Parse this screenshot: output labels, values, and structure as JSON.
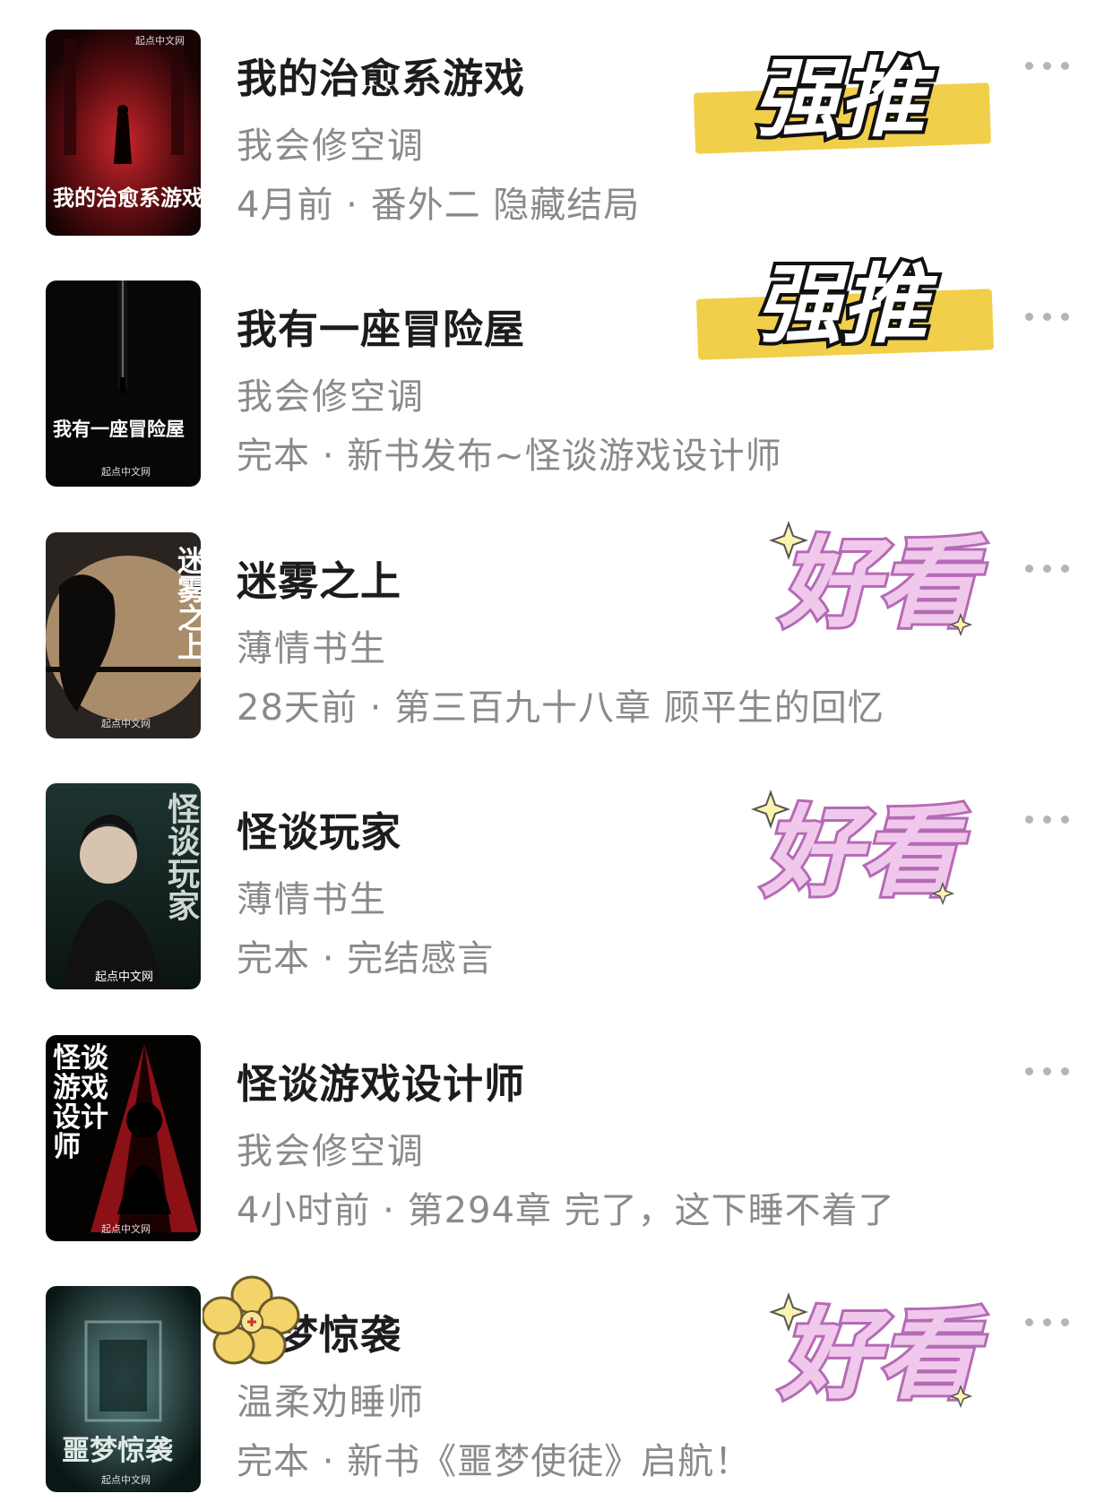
{
  "books": [
    {
      "title": "我的治愈系游戏",
      "author": "我会修空调",
      "meta": "4月前 · 番外二 隐藏结局",
      "cover_text": "我的治愈系游戏",
      "cover_publisher": "起点中文网",
      "badge": "强推"
    },
    {
      "title": "我有一座冒险屋",
      "author": "我会修空调",
      "meta": "完本 · 新书发布~怪谈游戏设计师",
      "cover_text": "我有一座冒险屋",
      "cover_publisher": "起点中文网",
      "badge": "强推"
    },
    {
      "title": "迷雾之上",
      "author": "薄情书生",
      "meta": "28天前 · 第三百九十八章 顾平生的回忆",
      "cover_text": "迷雾之上",
      "cover_publisher": "起点中文网",
      "badge": "好看"
    },
    {
      "title": "怪谈玩家",
      "author": "薄情书生",
      "meta": "完本 · 完结感言",
      "cover_text": "怪谈玩家",
      "cover_publisher": "起点中文网",
      "badge": "好看"
    },
    {
      "title": "怪谈游戏设计师",
      "author": "我会修空调",
      "meta": "4小时前 · 第294章 完了，这下睡不着了",
      "cover_text": "怪谈游戏设计师",
      "cover_publisher": "起点中文网",
      "badge": ""
    },
    {
      "title": "噩梦惊袭",
      "author": "温柔劝睡师",
      "meta": "完本 · 新书《噩梦使徒》启航！",
      "cover_text": "噩梦惊袭",
      "cover_publisher": "起点中文网",
      "badge": "好看"
    }
  ],
  "colors": {
    "title": "#1c1c1c",
    "secondary": "#8a8a8a",
    "strong_badge_highlight": "#f2cf4a",
    "good_badge_pink": "#f0c8ec",
    "good_badge_outline": "#b56ab5"
  },
  "icons": [
    "more-icon",
    "sparkle-icon",
    "flower-sticker-icon"
  ]
}
